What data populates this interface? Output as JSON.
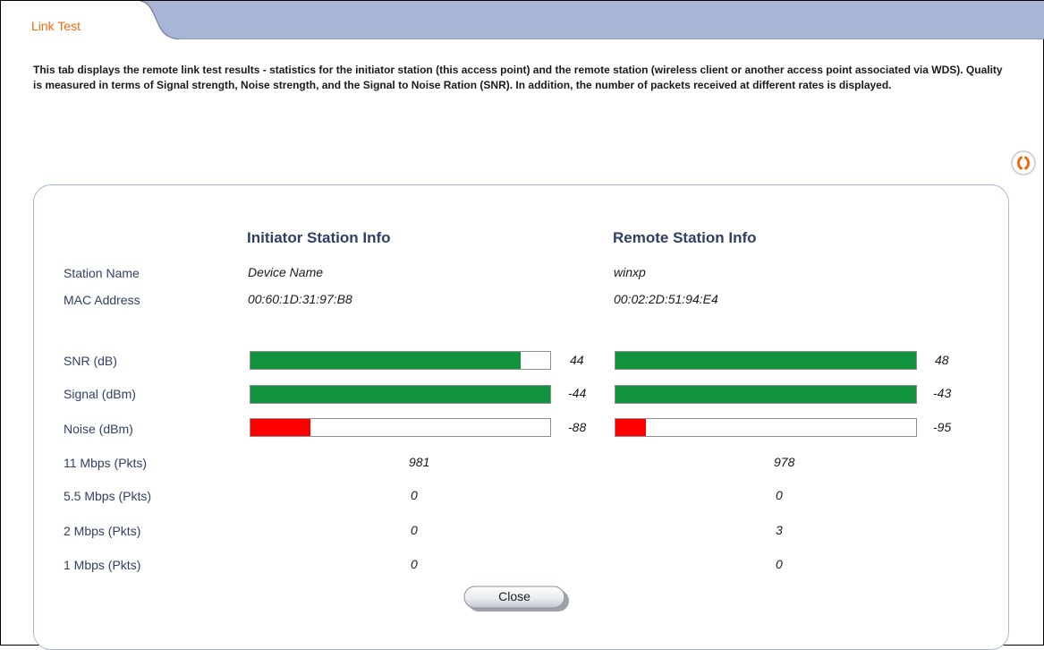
{
  "tab": {
    "label": "Link Test"
  },
  "description": "This tab displays the remote link test results - statistics for the initiator station (this access point) and the remote station (wireless client or another access point associated via WDS). Quality is measured in terms of Signal strength, Noise strength, and the Signal to Noise Ration (SNR). In addition, the number of packets received at different rates is displayed.",
  "columns": {
    "initiator": "Initiator Station Info",
    "remote": "Remote Station Info"
  },
  "labels": {
    "station_name": "Station Name",
    "mac_address": "MAC Address",
    "snr": "SNR (dB)",
    "signal": "Signal (dBm)",
    "noise": "Noise (dBm)",
    "mbps11": "11 Mbps (Pkts)",
    "mbps5_5": "5.5 Mbps (Pkts)",
    "mbps2": "2 Mbps (Pkts)",
    "mbps1": "1 Mbps (Pkts)"
  },
  "initiator": {
    "station_name": "Device Name",
    "mac_address": "00:60:1D:31:97:B8",
    "snr": "44",
    "signal": "-44",
    "noise": "-88",
    "snr_level": 0.9,
    "signal_level": 1.0,
    "noise_level": 0.2,
    "mbps11": "981",
    "mbps5_5": "0",
    "mbps2": "0",
    "mbps1": "0"
  },
  "remote": {
    "station_name": "winxp",
    "mac_address": "00:02:2D:51:94:E4",
    "snr": "48",
    "signal": "-43",
    "noise": "-95",
    "snr_level": 1.0,
    "signal_level": 1.0,
    "noise_level": 0.1,
    "mbps11": "978",
    "mbps5_5": "0",
    "mbps2": "3",
    "mbps1": "0"
  },
  "colors": {
    "good": "#11923c",
    "bad": "#ff0000",
    "tab_text": "#f26a10",
    "header_bar": "#a9b5d4"
  },
  "close_button": {
    "label": "Close"
  },
  "icons": {
    "help": "help-icon"
  }
}
